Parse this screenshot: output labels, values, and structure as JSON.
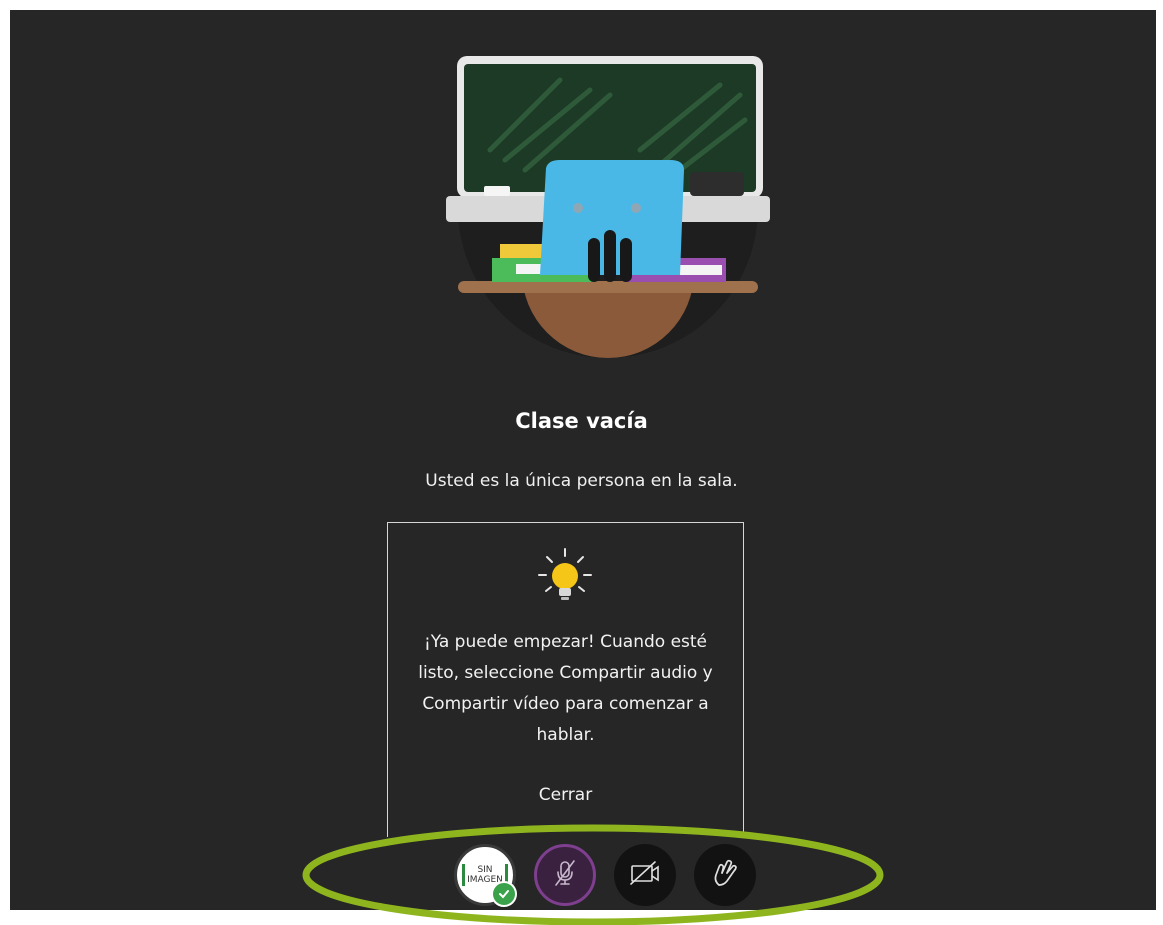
{
  "room": {
    "title": "Clase vacía",
    "subtitle": "Usted es la única persona en la sala."
  },
  "tip": {
    "icon": "lightbulb-icon",
    "text": "¡Ya puede empezar! Cuando esté listo, seleccione Compartir audio y Compartir vídeo para comenzar a hablar.",
    "close_label": "Cerrar"
  },
  "controls": {
    "avatar_text_line1": "SIN",
    "avatar_text_line2": "IMAGEN",
    "avatar_status_icon": "check-icon",
    "mic_icon": "microphone-muted-icon",
    "camera_icon": "camera-off-icon",
    "hand_icon": "raise-hand-icon"
  },
  "colors": {
    "stage_background": "#262626",
    "highlight_ellipse": "#8fb51e",
    "mic_accent": "#7d3f8e",
    "status_green": "#3aa24a"
  }
}
